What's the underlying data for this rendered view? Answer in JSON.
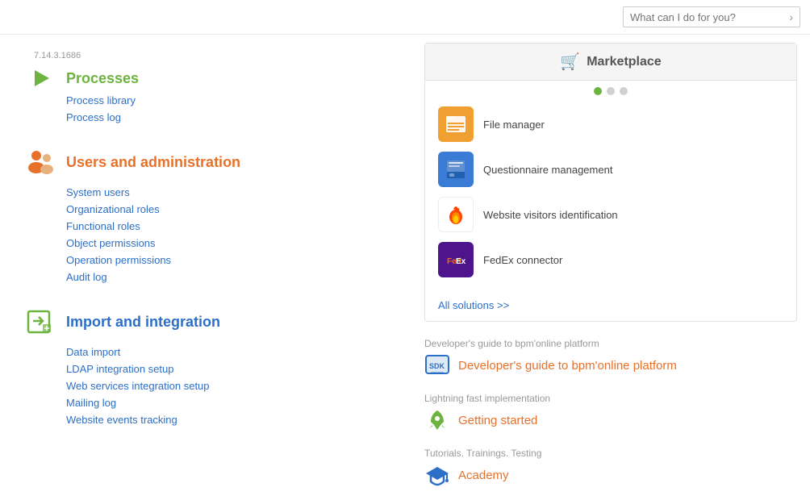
{
  "topbar": {
    "search_placeholder": "What can I do for you?"
  },
  "processes": {
    "version": "7.14.3.1686",
    "title": "Processes",
    "links": [
      {
        "label": "Process library",
        "id": "process-library"
      },
      {
        "label": "Process log",
        "id": "process-log"
      }
    ]
  },
  "users_admin": {
    "title": "Users and administration",
    "links": [
      {
        "label": "System users"
      },
      {
        "label": "Organizational roles"
      },
      {
        "label": "Functional roles"
      },
      {
        "label": "Object permissions"
      },
      {
        "label": "Operation permissions"
      },
      {
        "label": "Audit log"
      }
    ]
  },
  "import_integration": {
    "title": "Import and integration",
    "links": [
      {
        "label": "Data import"
      },
      {
        "label": "LDAP integration setup"
      },
      {
        "label": "Web services integration setup"
      },
      {
        "label": "Mailing log"
      },
      {
        "label": "Website events tracking"
      }
    ]
  },
  "marketplace": {
    "title": "Marketplace",
    "items": [
      {
        "label": "File manager",
        "icon_type": "file-manager"
      },
      {
        "label": "Questionnaire management",
        "icon_type": "questionnaire"
      },
      {
        "label": "Website visitors identification",
        "icon_type": "kickfire"
      },
      {
        "label": "FedEx connector",
        "icon_type": "fedex"
      }
    ],
    "dots": [
      {
        "active": true
      },
      {
        "active": false
      },
      {
        "active": false
      }
    ],
    "all_solutions_label": "All solutions >>"
  },
  "resources": [
    {
      "subtitle": "Developer's guide to bpm'online platform",
      "link_text": "Developer's guide to bpm'online platform",
      "icon_type": "sdk"
    },
    {
      "subtitle": "Lightning fast implementation",
      "link_text": "Getting started",
      "icon_type": "rocket"
    },
    {
      "subtitle": "Tutorials. Trainings. Testing",
      "link_text": "Academy",
      "icon_type": "academy"
    }
  ]
}
